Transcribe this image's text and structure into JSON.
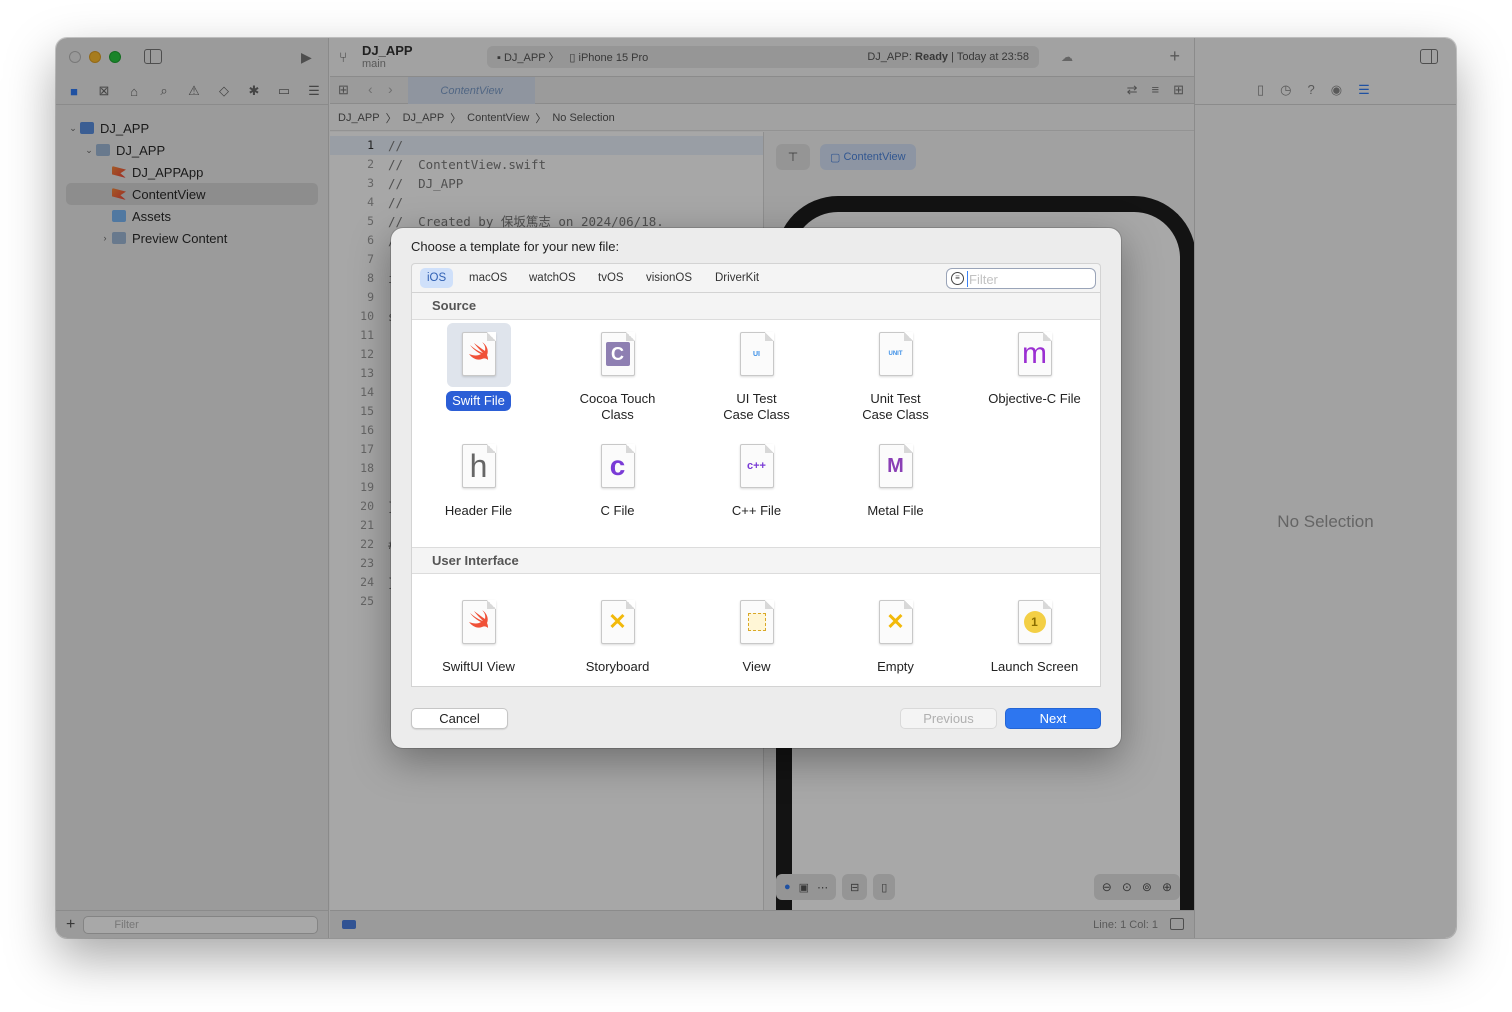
{
  "navigator": {
    "tree": [
      {
        "label": "DJ_APP",
        "kind": "project",
        "indent": 0,
        "disclosure": "open"
      },
      {
        "label": "DJ_APP",
        "kind": "folder",
        "indent": 1,
        "disclosure": "open"
      },
      {
        "label": "DJ_APPApp",
        "kind": "swift",
        "indent": 2,
        "disclosure": ""
      },
      {
        "label": "ContentView",
        "kind": "swift",
        "indent": 2,
        "disclosure": "",
        "selected": true
      },
      {
        "label": "Assets",
        "kind": "assets",
        "indent": 2,
        "disclosure": ""
      },
      {
        "label": "Preview Content",
        "kind": "folder",
        "indent": 2,
        "disclosure": "closed"
      }
    ],
    "filter_placeholder": "Filter"
  },
  "toolbar": {
    "project": "DJ_APP",
    "branch": "main",
    "scheme": "DJ_APP",
    "device": "iPhone 15 Pro",
    "status_prefix": "DJ_APP:",
    "status_bold": "Ready",
    "status_suffix": "| Today at 23:58"
  },
  "tabbar": {
    "active_tab": "ContentView"
  },
  "breadcrumb": {
    "items": [
      "DJ_APP",
      "DJ_APP",
      "ContentView",
      "No Selection"
    ]
  },
  "editor": {
    "current_line": 1,
    "line_count": 25,
    "lines": [
      "//",
      "//  ContentView.swift",
      "//  DJ_APP",
      "//",
      "//  Created by 保坂篤志 on 2024/06/18.",
      "//",
      "",
      "i",
      "",
      "s",
      "",
      "",
      "",
      "",
      "",
      "",
      "",
      "",
      "",
      "}",
      "",
      "#",
      "",
      "}",
      ""
    ]
  },
  "canvas": {
    "preview_label": "ContentView"
  },
  "statusbar": {
    "position": "Line: 1  Col: 1"
  },
  "inspector": {
    "empty_text": "No Selection"
  },
  "dialog": {
    "title": "Choose a template for your new file:",
    "platforms": [
      "iOS",
      "macOS",
      "watchOS",
      "tvOS",
      "visionOS",
      "DriverKit"
    ],
    "active_platform": "iOS",
    "filter_placeholder": "Filter",
    "sections": [
      {
        "name": "Source",
        "templates": [
          {
            "label": "Swift File",
            "icon": "swift-icon",
            "glyph": "",
            "selected": true
          },
          {
            "label": "Cocoa Touch\nClass",
            "icon": "cocoa-touch-class-icon",
            "glyph": "C"
          },
          {
            "label": "UI Test\nCase Class",
            "icon": "ui-test-icon",
            "glyph": "UI"
          },
          {
            "label": "Unit Test\nCase Class",
            "icon": "unit-test-icon",
            "glyph": "UNIT"
          },
          {
            "label": "Objective-C File",
            "icon": "objective-c-icon",
            "glyph": "m"
          },
          {
            "label": "Header File",
            "icon": "header-file-icon",
            "glyph": "h"
          },
          {
            "label": "C File",
            "icon": "c-file-icon",
            "glyph": "c"
          },
          {
            "label": "C++ File",
            "icon": "cpp-file-icon",
            "glyph": "c++"
          },
          {
            "label": "Metal File",
            "icon": "metal-file-icon",
            "glyph": "M"
          }
        ]
      },
      {
        "name": "User Interface",
        "templates": [
          {
            "label": "SwiftUI View",
            "icon": "swiftui-icon",
            "glyph": ""
          },
          {
            "label": "Storyboard",
            "icon": "storyboard-icon",
            "glyph": "✕"
          },
          {
            "label": "View",
            "icon": "view-icon",
            "glyph": ""
          },
          {
            "label": "Empty",
            "icon": "empty-icon",
            "glyph": "✕"
          },
          {
            "label": "Launch Screen",
            "icon": "launch-screen-icon",
            "glyph": "1"
          }
        ]
      }
    ],
    "buttons": {
      "cancel": "Cancel",
      "previous": "Previous",
      "next": "Next"
    }
  },
  "colors": {
    "accent": "#2d76f0",
    "selection": "#2b5ed6",
    "swift": "#f05138"
  }
}
